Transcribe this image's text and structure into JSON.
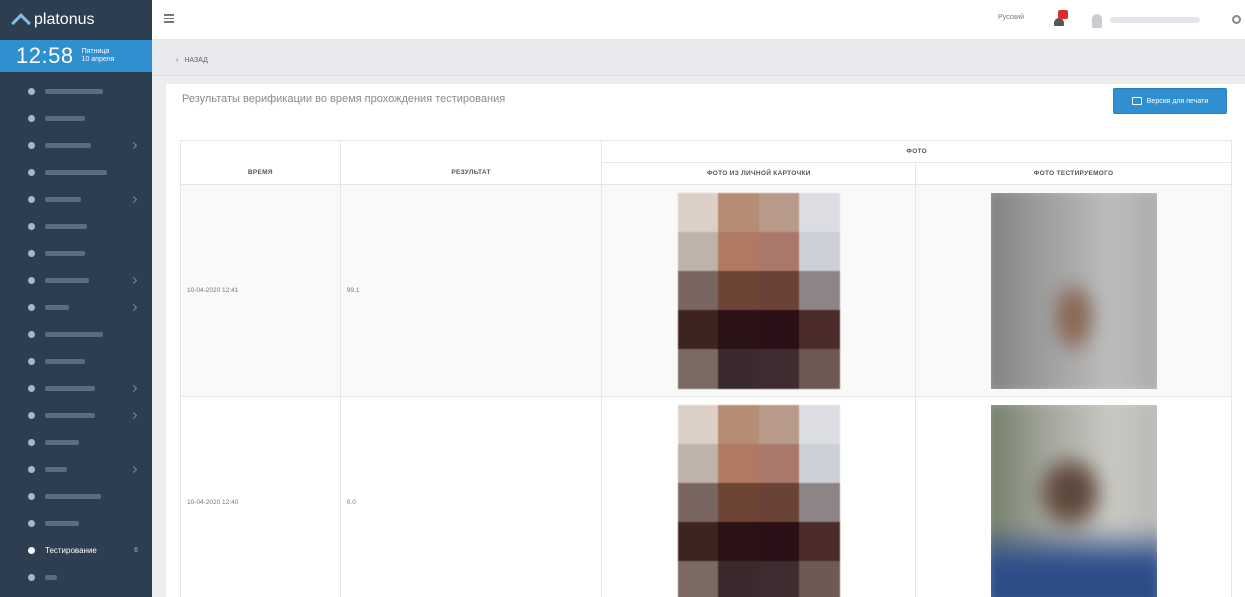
{
  "brand": "platonus",
  "clock": {
    "time": "12:58",
    "weekday": "Пятница",
    "date": "10 апреля"
  },
  "sidebar": {
    "items": [
      {
        "name": "item-1",
        "bar": 58,
        "chev": false
      },
      {
        "name": "item-2",
        "bar": 40,
        "chev": false
      },
      {
        "name": "item-3",
        "bar": 46,
        "chev": true
      },
      {
        "name": "item-4",
        "bar": 62,
        "chev": false
      },
      {
        "name": "item-5",
        "bar": 36,
        "chev": true
      },
      {
        "name": "item-6",
        "bar": 42,
        "chev": false
      },
      {
        "name": "item-7",
        "bar": 40,
        "chev": false
      },
      {
        "name": "item-8",
        "bar": 44,
        "chev": true
      },
      {
        "name": "item-9",
        "bar": 24,
        "chev": true
      },
      {
        "name": "item-10",
        "bar": 58,
        "chev": false
      },
      {
        "name": "item-11",
        "bar": 40,
        "chev": false
      },
      {
        "name": "item-12",
        "bar": 50,
        "chev": true
      },
      {
        "name": "item-13",
        "bar": 50,
        "chev": true
      },
      {
        "name": "item-14",
        "bar": 34,
        "chev": false
      },
      {
        "name": "item-15",
        "bar": 22,
        "chev": true
      },
      {
        "name": "item-16",
        "bar": 56,
        "chev": false
      },
      {
        "name": "item-17",
        "bar": 34,
        "chev": false
      }
    ],
    "active_label": "Тестирование",
    "active_badge": "6"
  },
  "topbar": {
    "language": "Русский",
    "notification_count": "1"
  },
  "breadcrumb": {
    "back_label": "НАЗАД"
  },
  "page": {
    "title": "Результаты верификации во время прохождения тестирования",
    "print_button": "Версия для печати"
  },
  "table": {
    "col_time": "ВРЕМЯ",
    "col_result": "РЕЗУЛЬТАТ",
    "col_photo_group": "ФОТО",
    "col_photo_card": "ФОТО ИЗ ЛИЧНОЙ КАРТОЧКИ",
    "col_photo_test": "ФОТО ТЕСТИРУЕМОГО",
    "rows": [
      {
        "time": "10-04-2020 12:41",
        "result": "99.1"
      },
      {
        "time": "10-04-2020 12:40",
        "result": "0.0"
      }
    ]
  },
  "colors": {
    "sidebar_bg": "#2c3e50",
    "accent": "#2f8fd0",
    "badge": "#e02b2b"
  }
}
